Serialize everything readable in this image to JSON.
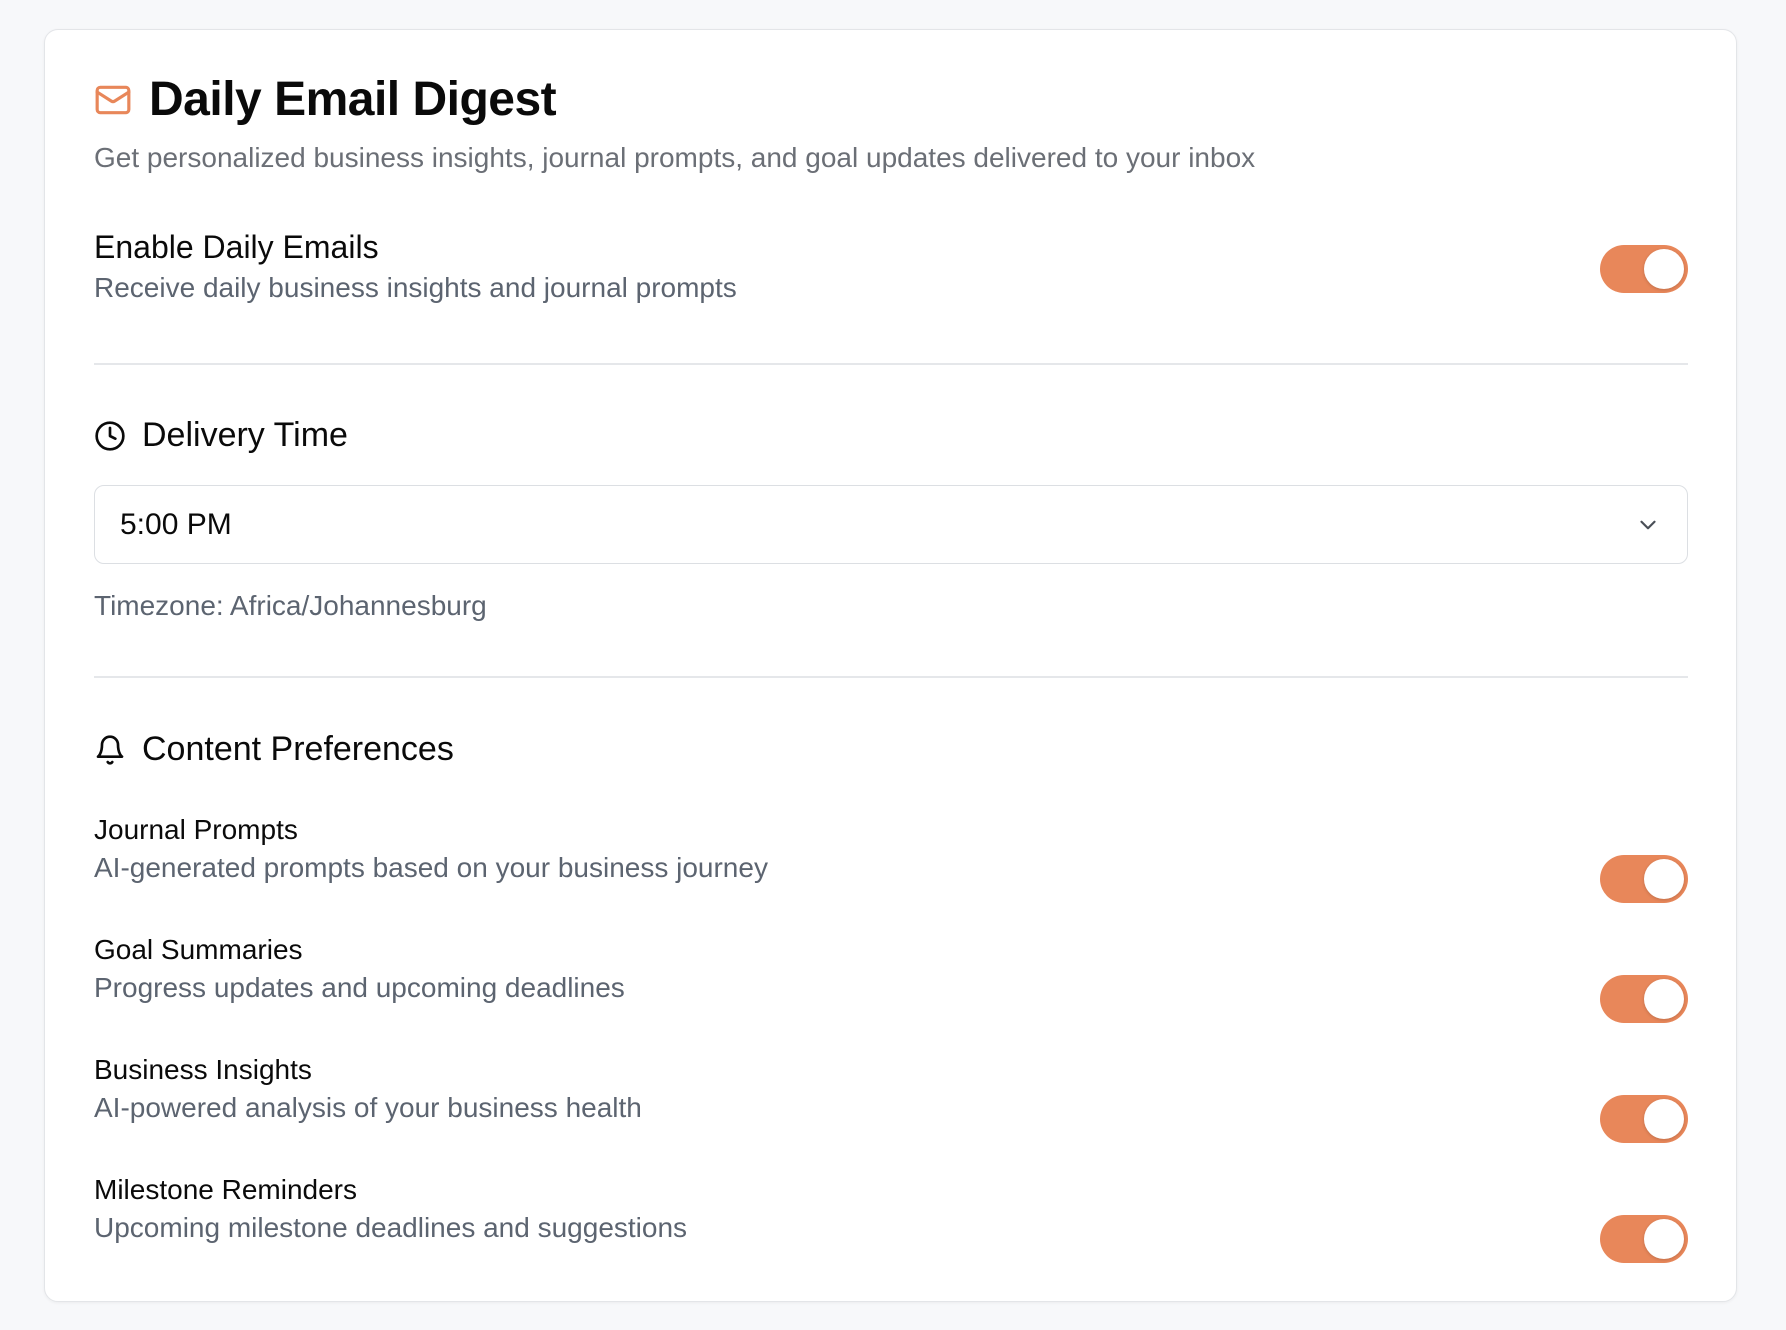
{
  "header": {
    "title": "Daily Email Digest",
    "subtitle": "Get personalized business insights, journal prompts, and goal updates delivered to your inbox",
    "icon": "mail-icon"
  },
  "enable": {
    "label": "Enable Daily Emails",
    "description": "Receive daily business insights and journal prompts",
    "enabled": true
  },
  "delivery": {
    "heading": "Delivery Time",
    "icon": "clock-icon",
    "selected_time": "5:00 PM",
    "timezone": "Timezone: Africa/Johannesburg"
  },
  "content": {
    "heading": "Content Preferences",
    "icon": "bell-icon",
    "items": [
      {
        "label": "Journal Prompts",
        "description": "AI-generated prompts based on your business journey",
        "enabled": true
      },
      {
        "label": "Goal Summaries",
        "description": "Progress updates and upcoming deadlines",
        "enabled": true
      },
      {
        "label": "Business Insights",
        "description": "AI-powered analysis of your business health",
        "enabled": true
      },
      {
        "label": "Milestone Reminders",
        "description": "Upcoming milestone deadlines and suggestions",
        "enabled": true
      }
    ]
  },
  "colors": {
    "accent": "#e8875a",
    "background": "#f7f8fa",
    "card": "#ffffff",
    "muted_text": "#5c6470"
  }
}
